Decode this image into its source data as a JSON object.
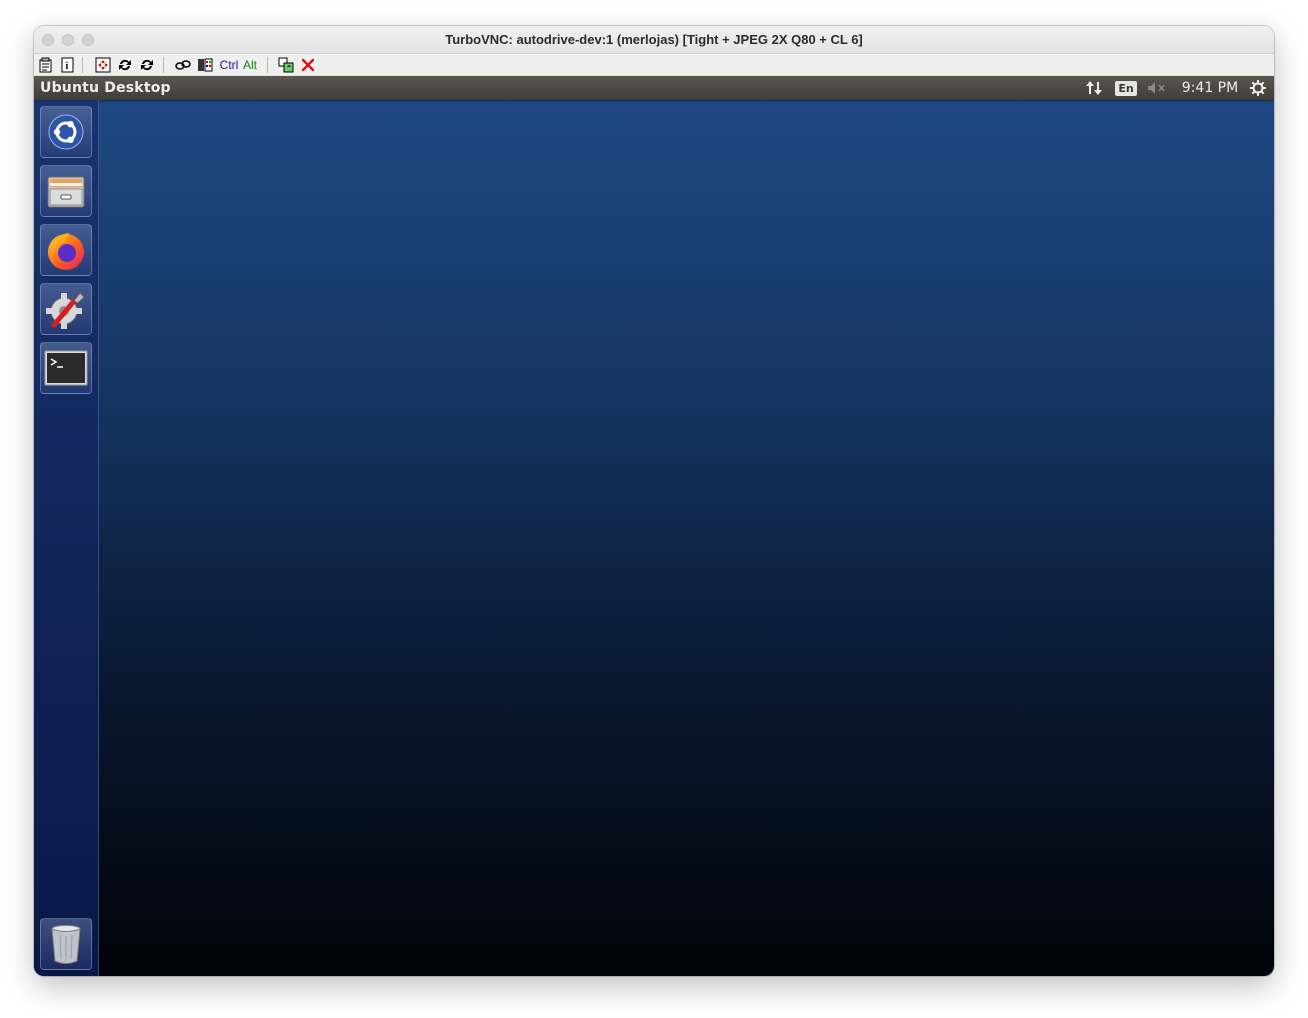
{
  "window": {
    "title": "TurboVNC: autodrive-dev:1 (merlojas) [Tight + JPEG 2X Q80 + CL 6]"
  },
  "toolbar": {
    "ctrl_label": "Ctrl",
    "alt_label": "Alt"
  },
  "panel": {
    "title": "Ubuntu Desktop",
    "keyboard_layout": "En",
    "clock": "9:41 PM"
  },
  "launcher": {
    "items": [
      "ubuntu-dash",
      "files",
      "firefox",
      "system-settings",
      "terminal",
      "trash"
    ]
  },
  "colors": {
    "desktop_top": "#1f4a86",
    "desktop_bottom": "#010308",
    "panel": "#4a4843",
    "launcher": "#13286a"
  }
}
